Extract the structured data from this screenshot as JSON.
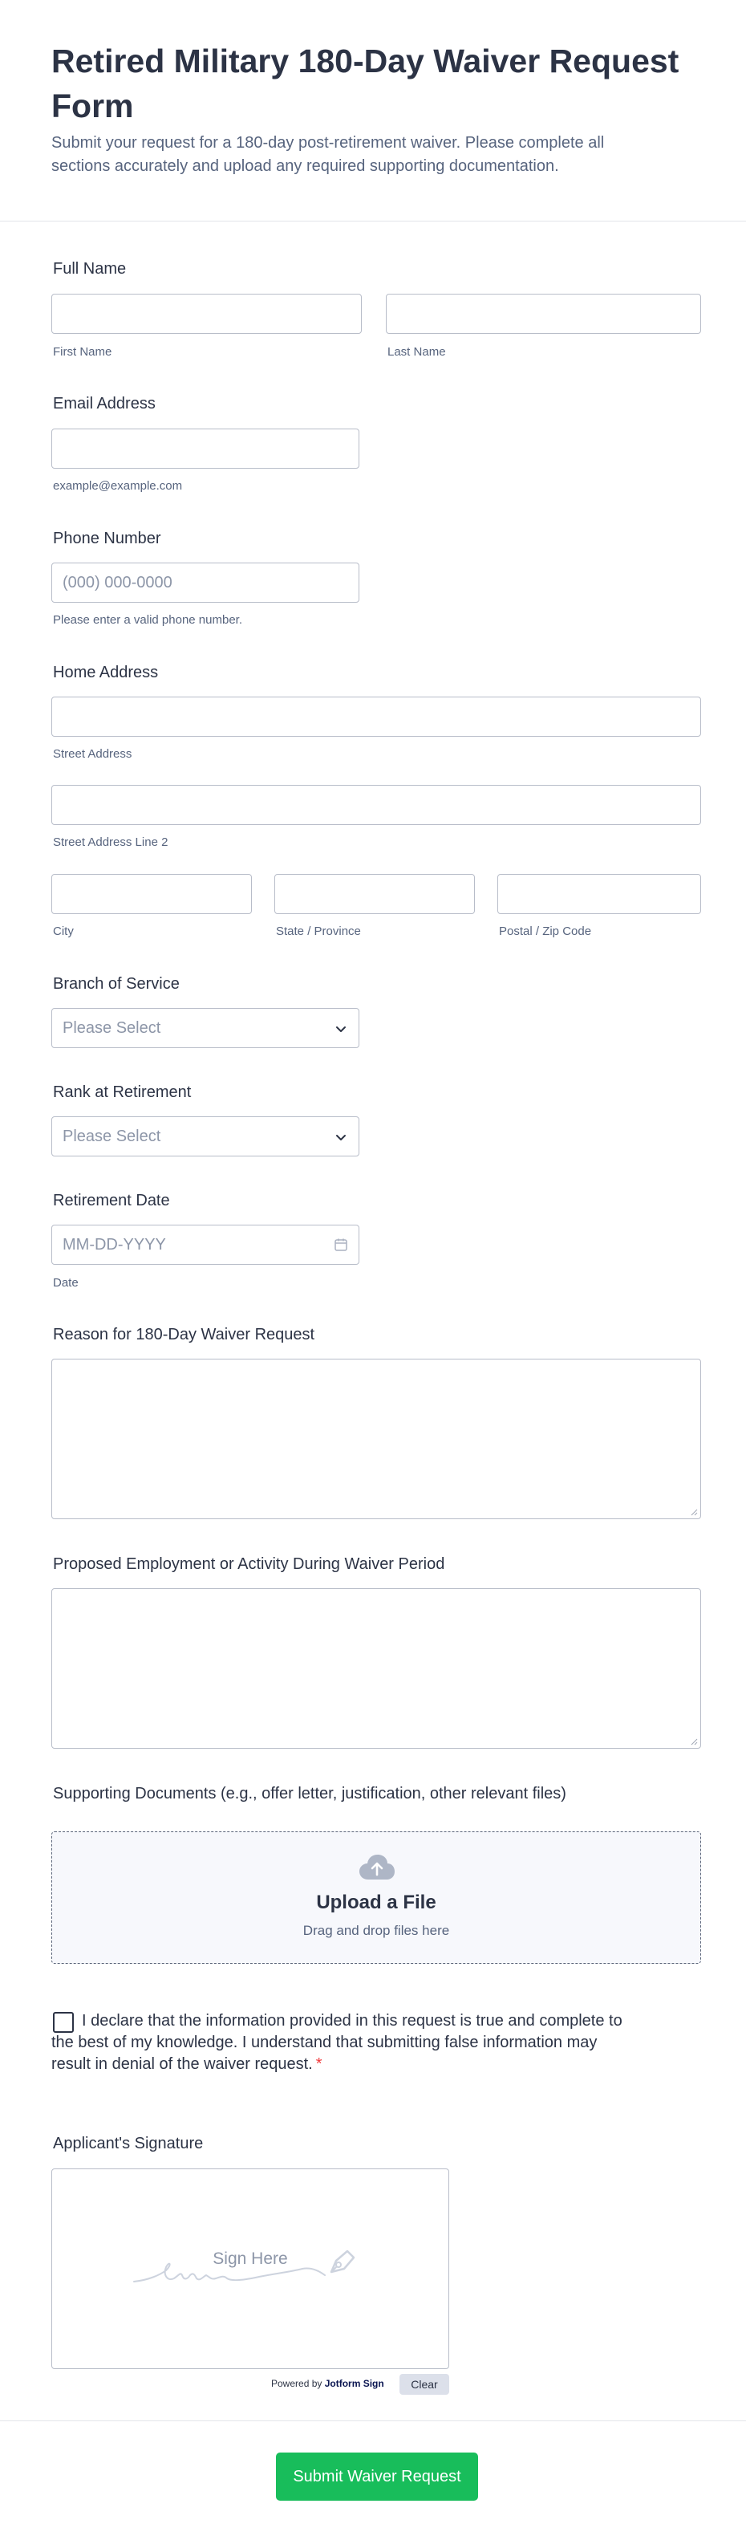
{
  "header": {
    "title": "Retired Military 180-Day Waiver Request Form",
    "subtitle": "Submit your request for a 180-day post-retirement waiver. Please complete all sections accurately and upload any required supporting documentation."
  },
  "full_name": {
    "label": "Full Name",
    "first_sublabel": "First Name",
    "last_sublabel": "Last Name"
  },
  "email": {
    "label": "Email Address",
    "sublabel": "example@example.com"
  },
  "phone": {
    "label": "Phone Number",
    "placeholder": "(000) 000-0000",
    "sublabel": "Please enter a valid phone number."
  },
  "address": {
    "label": "Home Address",
    "street_sublabel": "Street Address",
    "street2_sublabel": "Street Address Line 2",
    "city_sublabel": "City",
    "state_sublabel": "State / Province",
    "zip_sublabel": "Postal / Zip Code"
  },
  "branch": {
    "label": "Branch of Service",
    "selected": "Please Select"
  },
  "rank": {
    "label": "Rank at Retirement",
    "selected": "Please Select"
  },
  "retirement_date": {
    "label": "Retirement Date",
    "placeholder": "MM-DD-YYYY",
    "sublabel": "Date"
  },
  "reason": {
    "label": "Reason for 180-Day Waiver Request"
  },
  "employment": {
    "label": "Proposed Employment or Activity During Waiver Period"
  },
  "documents": {
    "label": "Supporting Documents (e.g., offer letter, justification, other relevant files)",
    "upload_title": "Upload a File",
    "upload_sub": "Drag and drop files here"
  },
  "declaration": {
    "text": "I declare that the information provided in this request is true and complete to the best of my knowledge. I understand that submitting false information may result in denial of the waiver request.",
    "required_mark": "*"
  },
  "signature": {
    "label": "Applicant's Signature",
    "placeholder": "Sign Here",
    "powered_prefix": "Powered by",
    "powered_brand": "Jotform Sign",
    "clear_label": "Clear"
  },
  "submit": {
    "label": "Submit Waiver Request"
  },
  "icons": {
    "chevron": "chevron-down-icon",
    "calendar": "calendar-icon",
    "upload": "cloud-upload-icon",
    "signature": "pen-nib-icon"
  },
  "colors": {
    "accent": "#18bd5b",
    "required": "#f23a3c",
    "text": "#2c3345",
    "muted": "#57647e"
  }
}
